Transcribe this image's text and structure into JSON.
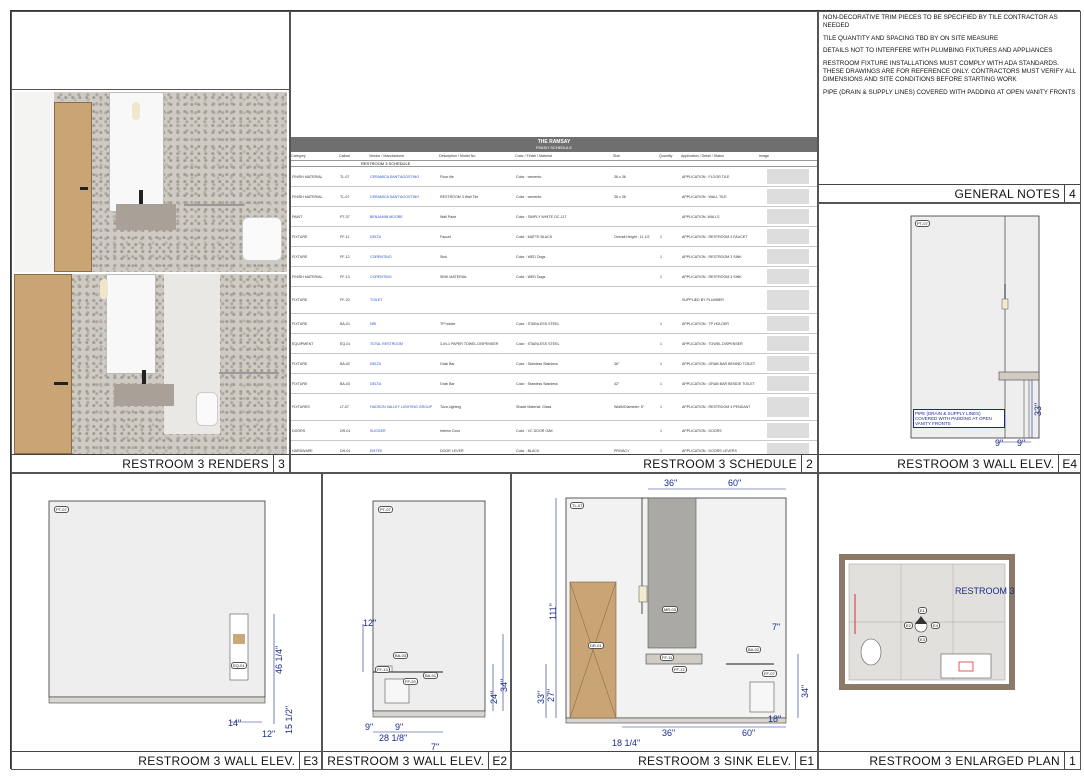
{
  "panels": {
    "renders": {
      "title": "RESTROOM 3 RENDERS",
      "number": "3"
    },
    "schedule": {
      "title": "RESTROOM 3 SCHEDULE",
      "number": "2"
    },
    "notes": {
      "title": "GENERAL NOTES",
      "number": "4"
    },
    "elev_e4": {
      "title": "RESTROOM 3 WALL ELEV.",
      "number": "E4"
    },
    "elev_e3": {
      "title": "RESTROOM 3 WALL ELEV.",
      "number": "E3"
    },
    "elev_e2": {
      "title": "RESTROOM 3 WALL ELEV.",
      "number": "E2"
    },
    "elev_e1": {
      "title": "RESTROOM 3 SINK ELEV.",
      "number": "E1"
    },
    "plan": {
      "title": "RESTROOM 3 ENLARGED PLAN",
      "number": "1"
    }
  },
  "general_notes": [
    "NON-DECORATIVE TRIM PIECES TO BE SPECIFIED BY TILE CONTRACTOR AS NEEDED",
    "TILE QUANTITY AND SPACING TBD BY ON SITE MEASURE",
    "DETAILS NOT TO INTERFERE WITH PLUMBING FIXTURES AND APPLIANCES",
    "RESTROOM FIXTURE INSTALLATIONS MUST COMPLY WITH ADA STANDARDS. THESE DRAWINGS ARE FOR REFERENCE ONLY. CONTRACTORS MUST VERIFY ALL DIMENSIONS AND SITE CONDITIONS BEFORE STARTING WORK",
    "PIPE (DRAIN & SUPPLY LINES) COVERED WITH PADDING AT OPEN VANITY FRONTS"
  ],
  "schedule": {
    "project": "THE RAMSAY",
    "subtitle": "FINISH SCHEDULE",
    "section": "RESTROOM 3 SCHEDULE",
    "columns": [
      "Category",
      "Callout",
      "Vendor / Manufacturer",
      "Description / Model No.",
      "Color / Finish / Material",
      "Size",
      "Quantity",
      "Application / Detail / Status",
      "Image"
    ],
    "rows": [
      [
        "FINISH MATERIAL",
        "TL-07",
        "CERAMICA SANT'AGOSTINO",
        "Floor tile",
        "Color : cemento",
        "36 x 36",
        "",
        "APPLICATION : FLOOR TILE"
      ],
      [
        "FINISH MATERIAL",
        "TL-07",
        "CERAMICA SANT'AGOSTINO",
        "RESTROOM 3 Wall Tile",
        "Color : cemento",
        "36 x 36",
        "",
        "APPLICATION : WALL TILE"
      ],
      [
        "PAINT",
        "PT-07",
        "BENJAMIN MOORE",
        "Wall Paint",
        "Color : SIMPLY WHITE OC-117",
        "",
        "",
        "APPLICATION: WALLS"
      ],
      [
        "FIXTURE",
        "FF-11",
        "DELTA",
        "Faucet",
        "Color : MATTE BLACK",
        "Overall Height : 11 1/2",
        "1",
        "APPLICATION : RESTROOM 3 FAUCET"
      ],
      [
        "FIXTURE",
        "FF-12",
        "CORENTINO",
        "Sink",
        "Color : WED Dogs",
        "",
        "1",
        "APPLICATION : RESTROOM 3 SINK"
      ],
      [
        "FINISH MATERIAL",
        "FF-13",
        "CORENTINO",
        "SINK MATERIAL",
        "Color : WED Dogs",
        "",
        "1",
        "APPLICATION : RESTROOM 3 SINK"
      ],
      [
        "FIXTURE",
        "FF-20",
        "TOILET",
        "",
        "",
        "",
        "",
        "SUPPLIED BY PLUMBER"
      ],
      [
        "FIXTURE",
        "BA-01",
        "NRI",
        "TP holder",
        "Color : STAINLESS STEEL",
        "",
        "1",
        "APPLICATION : TP HOLDER"
      ],
      [
        "EQUIPMENT",
        "EQ-01",
        "TOTAL RESTROOM",
        "3-IN-1 PAPER TOWEL DISPENSER",
        "Color : STAINLESS STEEL",
        "",
        "1",
        "APPLICATION : TOWEL DISPENSER"
      ],
      [
        "FIXTURE",
        "BA-02",
        "DELTA",
        "Grab Bar",
        "Color : Stainless Stainless",
        "36\"",
        "1",
        "APPLICATION : GRAB BAR BEHIND TOILET"
      ],
      [
        "FIXTURE",
        "BA-03",
        "DELTA",
        "Grab Bar",
        "Color : Stainless Stainless",
        "42\"",
        "1",
        "APPLICATION : GRAB BAR BESIDE TOILET"
      ],
      [
        "FIXTURES",
        "LT-07",
        "HUDSON VALLEY LIGHTING GROUP",
        "Tova Lighting",
        "Shade Material: Glass",
        "Width/Diameter: 5\"",
        "1",
        "APPLICATION : RESTROOM 3 PENDANT"
      ],
      [
        "DOORS",
        "DR-01",
        "SUGGER",
        "Interior Door",
        "Color : VC DOOR OAK",
        "",
        "1",
        "APPLICATION : DOORS"
      ],
      [
        "HARDWARE",
        "DH-01",
        "EMTEK",
        "DOOR LEVER",
        "Color : BLACK",
        "PRIVACY",
        "1",
        "APPLICATION : DOORS LEVERS"
      ],
      [
        "FIXTURE",
        "MR-03",
        "CUSTOM",
        "Mirror",
        "Material : GLASS",
        "H: 111\" W: 36\"",
        "1",
        "APPLICATION : RESTROOM 3 MIRROR"
      ]
    ]
  },
  "e4": {
    "tag": "PT-07",
    "dims": [
      "33\"",
      "9\"",
      "9\""
    ],
    "note": "PIPE (DRAIN & SUPPLY LINES) COVERED WITH PADDING AT OPEN VANITY FRONTS"
  },
  "e3": {
    "tag": "PT-07",
    "dims": [
      "46 1/4\"",
      "15 1/2\"",
      "14\"",
      "12\""
    ],
    "eq_tag": "EQ-01"
  },
  "e2": {
    "tag": "PT-07",
    "dims": [
      "12\"",
      "24\"",
      "34\"",
      "9\"",
      "9\"",
      "28 1/8\"",
      "7\""
    ],
    "tags": [
      "BA-03",
      "FF-13",
      "BA-01",
      "FF-20"
    ]
  },
  "e1": {
    "tag": "TL-07",
    "dims": [
      "36\"",
      "60\"",
      "111\"",
      "33\"",
      "27\"",
      "7\"",
      "34\"",
      "18\"",
      "36\"",
      "60\"",
      "18 1/4\""
    ],
    "tags": [
      "DR-01",
      "MR-03",
      "FF-11",
      "FF-12",
      "BA-02",
      "FF-07"
    ]
  },
  "plan": {
    "room": "RESTROOM 3",
    "elev_tags": [
      "E1",
      "E2",
      "E3",
      "E4"
    ]
  }
}
